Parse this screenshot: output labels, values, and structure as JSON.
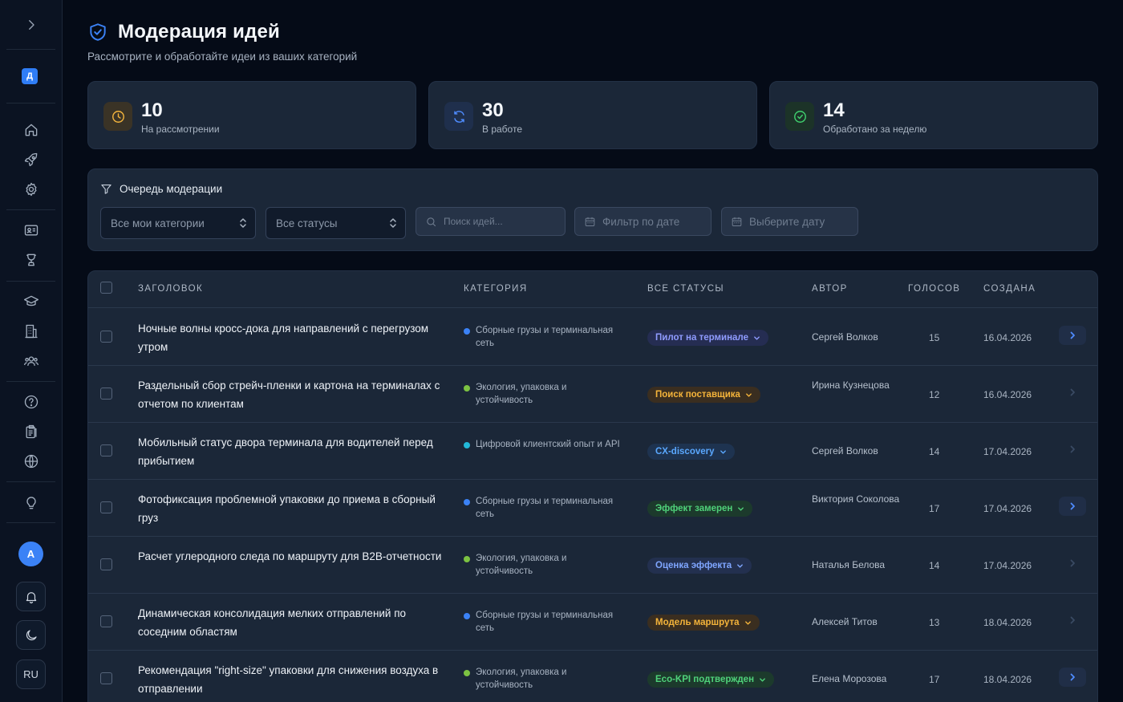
{
  "sidebar": {
    "logo_letter": "Д",
    "avatar_letter": "А",
    "lang": "RU"
  },
  "header": {
    "title": "Модерация идей",
    "subtitle": "Рассмотрите и обработайте идеи из ваших категорий"
  },
  "stats": [
    {
      "value": "10",
      "label": "На рассмотрении",
      "icon": "clock-icon",
      "color": "#f2b33d",
      "bg": "#3a3326"
    },
    {
      "value": "30",
      "label": "В работе",
      "icon": "refresh-icon",
      "color": "#4f8cff",
      "bg": "#1f2f4c"
    },
    {
      "value": "14",
      "label": "Обработано за неделю",
      "icon": "check-circle-icon",
      "color": "#3fcf6e",
      "bg": "#1c3328"
    }
  ],
  "filters": {
    "title": "Очередь модерации",
    "category_select": "Все мои категории",
    "status_select": "Все статусы",
    "search_placeholder": "Поиск идей...",
    "date_filter": "Фильтр по дате",
    "date_pick": "Выберите дату"
  },
  "table": {
    "columns": {
      "title": "ЗАГОЛОВОК",
      "category": "КАТЕГОРИЯ",
      "status": "ВСЕ СТАТУСЫ",
      "author": "АВТОР",
      "votes": "ГОЛОСОВ",
      "created": "СОЗДАНА"
    },
    "rows": [
      {
        "title": "Ночные волны кросс-дока для направлений с перегрузом утром",
        "category": "Сборные грузы и терминальная сеть",
        "cat_color": "#3b82f6",
        "status": "Пилот на терминале",
        "st_color": "#8f9bff",
        "st_bg": "#252d52",
        "author": "Сергей Волков",
        "votes": "15",
        "date": "16.04.2026",
        "go_active": true
      },
      {
        "title": "Раздельный сбор стрейч-пленки и картона на терминалах с отчетом по клиентам",
        "category": "Экология, упаковка и устойчивость",
        "cat_color": "#7cc242",
        "status": "Поиск поставщика",
        "st_color": "#f5b43a",
        "st_bg": "#3a2e20",
        "author": "Ирина Кузнецова",
        "votes": "12",
        "date": "16.04.2026",
        "go_active": false
      },
      {
        "title": "Мобильный статус двора терминала для водителей перед прибытием",
        "category": "Цифровой клиентский опыт и API",
        "cat_color": "#22b8d8",
        "status": "CX-discovery",
        "st_color": "#5aa8ff",
        "st_bg": "#1e3350",
        "author": "Сергей Волков",
        "votes": "14",
        "date": "17.04.2026",
        "go_active": false
      },
      {
        "title": "Фотофиксация проблемной упаковки до приема в сборный груз",
        "category": "Сборные грузы и терминальная сеть",
        "cat_color": "#3b82f6",
        "status": "Эффект замерен",
        "st_color": "#4fd27a",
        "st_bg": "#1c3a2c",
        "author": "Виктория Соколова",
        "votes": "17",
        "date": "17.04.2026",
        "go_active": true
      },
      {
        "title": "Расчет углеродного следа по маршруту для B2B-отчетности",
        "category": "Экология, упаковка и устойчивость",
        "cat_color": "#7cc242",
        "status": "Оценка эффекта",
        "st_color": "#7fa6ff",
        "st_bg": "#23304f",
        "author": "Наталья Белова",
        "votes": "14",
        "date": "17.04.2026",
        "go_active": false
      },
      {
        "title": "Динамическая консолидация мелких отправлений по соседним областям",
        "category": "Сборные грузы и терминальная сеть",
        "cat_color": "#3b82f6",
        "status": "Модель маршрута",
        "st_color": "#f5b43a",
        "st_bg": "#3a2e20",
        "author": "Алексей Титов",
        "votes": "13",
        "date": "18.04.2026",
        "go_active": false
      },
      {
        "title": "Рекомендация \"right-size\" упаковки для снижения воздуха в отправлении",
        "category": "Экология, упаковка и устойчивость",
        "cat_color": "#7cc242",
        "status": "Eco-KPI подтвержден",
        "st_color": "#4fd27a",
        "st_bg": "#1c3a2c",
        "author": "Елена Морозова",
        "votes": "17",
        "date": "18.04.2026",
        "go_active": true
      }
    ]
  }
}
